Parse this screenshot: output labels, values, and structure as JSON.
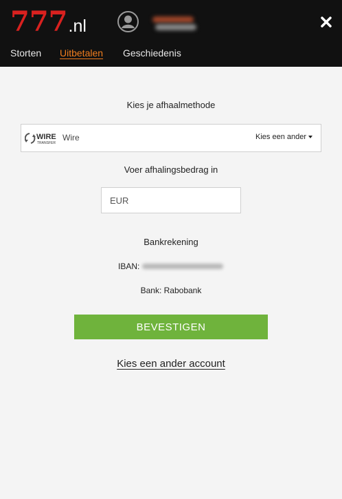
{
  "brand": {
    "logo_number": "777",
    "logo_tld": ".nl",
    "color_red": "#d8211f",
    "color_accent": "#f07d1e",
    "color_confirm": "#6fb33c"
  },
  "header": {
    "avatar_icon": "user-avatar-icon",
    "close_icon": "close-x-icon"
  },
  "tabs": [
    {
      "label": "Storten",
      "active": false
    },
    {
      "label": "Uitbetalen",
      "active": true
    },
    {
      "label": "Geschiedenis",
      "active": false
    }
  ],
  "withdraw": {
    "method_heading": "Kies je afhaalmethode",
    "method": {
      "logo_line1": "WIRE",
      "logo_line2": "TRANSFER",
      "name": "Wire",
      "change_label": "Kies een ander"
    },
    "amount_heading": "Voer afhalingsbedrag in",
    "amount_placeholder": "EUR",
    "account_heading": "Bankrekening",
    "iban_label": "IBAN:",
    "bank_text": "Bank: Rabobank",
    "confirm_label": "BEVESTIGEN",
    "other_account_label": "Kies een ander account"
  }
}
